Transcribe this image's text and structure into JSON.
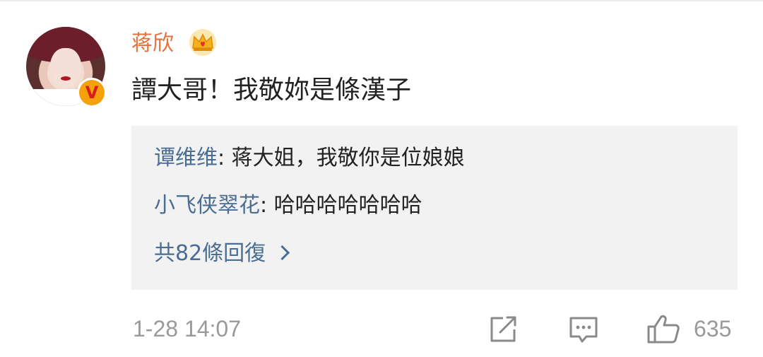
{
  "comment": {
    "username": "蒋欣",
    "text": "譚大哥！我敬妳是條漢子",
    "timestamp": "1-28 14:07",
    "like_count": "635",
    "verified_badge_letter": "V",
    "icons": {
      "crown": "crown-icon",
      "share": "share-icon",
      "reply": "comment-icon",
      "like": "like-icon"
    }
  },
  "replies": [
    {
      "author": "谭维维",
      "separator": ": ",
      "text": "蒋大姐，我敬你是位娘娘"
    },
    {
      "author": "小飞侠翠花",
      "separator": ": ",
      "text": "哈哈哈哈哈哈哈"
    }
  ],
  "reply_count_label": "共82條回復",
  "colors": {
    "username": "#e5713b",
    "reply_author": "#4a6d93",
    "reply_background": "#f2f2f2",
    "muted": "#9a9a9a"
  }
}
